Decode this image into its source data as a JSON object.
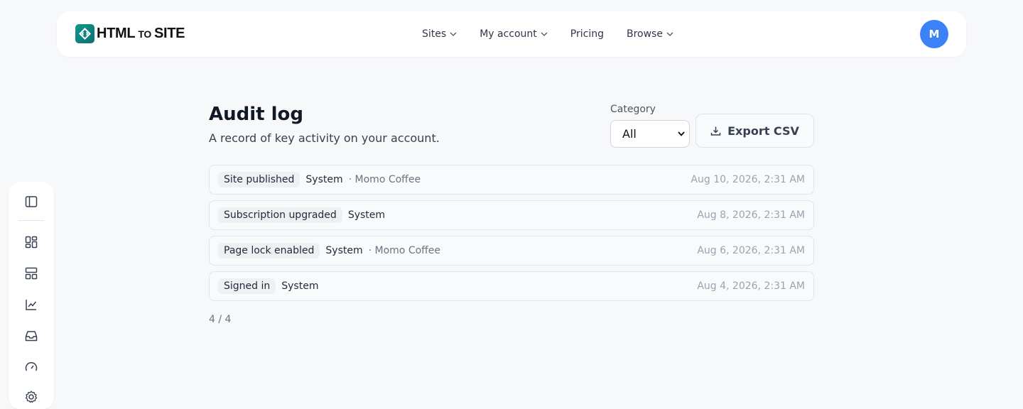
{
  "header": {
    "logo_main": "HTML",
    "logo_small": "TO",
    "logo_end": "SITE",
    "nav": [
      {
        "label": "Sites",
        "has_chevron": true
      },
      {
        "label": "My account",
        "has_chevron": true
      },
      {
        "label": "Pricing",
        "has_chevron": false
      },
      {
        "label": "Browse",
        "has_chevron": true
      }
    ],
    "avatar_initial": "M",
    "avatar_color": "#3b82f6"
  },
  "rail": {
    "icons": [
      "sidebar-toggle-icon",
      "dashboard-icon",
      "layout-icon",
      "chart-icon",
      "inbox-icon",
      "gauge-icon",
      "gear-icon"
    ]
  },
  "main": {
    "title": "Audit log",
    "subtitle": "A record of key activity on your account.",
    "category_label": "Category",
    "category_value": "All",
    "export_label": "Export CSV",
    "entries": [
      {
        "event": "Site published",
        "actor": "System",
        "site": "· Momo Coffee",
        "time": "Aug 10, 2026, 2:31 AM"
      },
      {
        "event": "Subscription upgraded",
        "actor": "System",
        "site": "",
        "time": "Aug 8, 2026, 2:31 AM"
      },
      {
        "event": "Page lock enabled",
        "actor": "System",
        "site": "· Momo Coffee",
        "time": "Aug 6, 2026, 2:31 AM"
      },
      {
        "event": "Signed in",
        "actor": "System",
        "site": "",
        "time": "Aug 4, 2026, 2:31 AM"
      }
    ],
    "count": "4 / 4"
  }
}
